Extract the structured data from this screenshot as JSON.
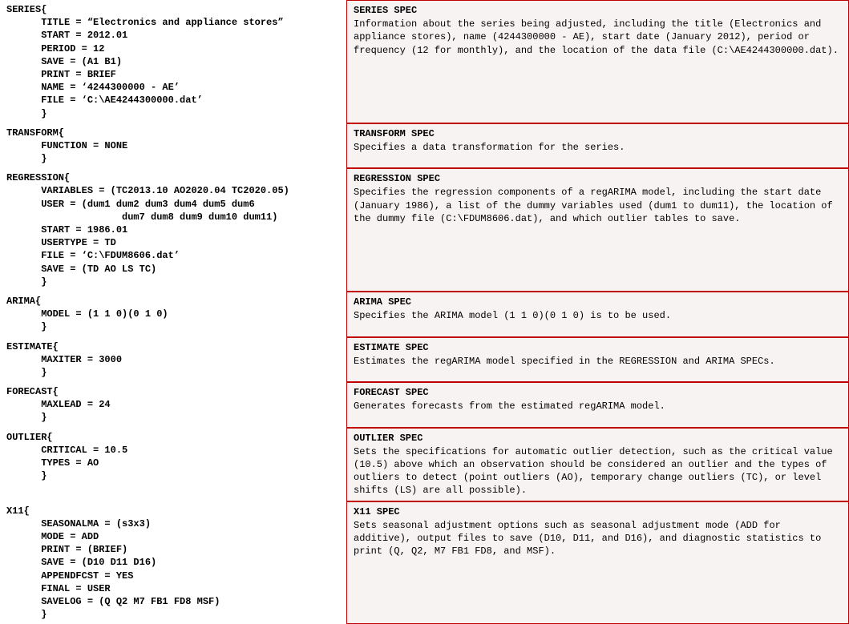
{
  "specs": [
    {
      "id": "series",
      "code": "SERIES{\n      TITLE = “Electronics and appliance stores”\n      START = 2012.01\n      PERIOD = 12\n      SAVE = (A1 B1)\n      PRINT = BRIEF\n      NAME = ‘4244300000 - AE’\n      FILE = ‘C:\\AE4244300000.dat’\n      }",
      "title": "SERIES SPEC",
      "desc": "Information about the series being adjusted, including the title (Electronics and appliance stores), name (4244300000 - AE), start date (January 2012), period or frequency (12 for monthly), and the location of the data file (C:\\AE4244300000.dat)."
    },
    {
      "id": "transform",
      "code": "TRANSFORM{\n      FUNCTION = NONE\n      }",
      "title": "TRANSFORM SPEC",
      "desc": "Specifies a data transformation for the series."
    },
    {
      "id": "regression",
      "code": "REGRESSION{\n      VARIABLES = (TC2013.10 AO2020.04 TC2020.05)\n      USER = (dum1 dum2 dum3 dum4 dum5 dum6\n                    dum7 dum8 dum9 dum10 dum11)\n      START = 1986.01\n      USERTYPE = TD\n      FILE = ‘C:\\FDUM8606.dat’\n      SAVE = (TD AO LS TC)\n      }",
      "title": "REGRESSION SPEC",
      "desc": "Specifies the regression components of a regARIMA model, including the start date (January 1986), a list of the dummy variables used (dum1 to dum11), the location of the dummy file (C:\\FDUM8606.dat), and which outlier tables to save."
    },
    {
      "id": "arima",
      "code": "ARIMA{\n      MODEL = (1 1 0)(0 1 0)\n      }",
      "title": "ARIMA SPEC",
      "desc": "Specifies the ARIMA model (1 1 0)(0 1 0) is to be used."
    },
    {
      "id": "estimate",
      "code": "ESTIMATE{\n      MAXITER = 3000\n      }",
      "title": "ESTIMATE SPEC",
      "desc": "Estimates the regARIMA model specified in the REGRESSION and ARIMA SPECs."
    },
    {
      "id": "forecast",
      "code": "FORECAST{\n      MAXLEAD = 24\n      }",
      "title": "FORECAST SPEC",
      "desc": "Generates forecasts from the estimated regARIMA model."
    },
    {
      "id": "outlier",
      "code": "OUTLIER{\n      CRITICAL = 10.5\n      TYPES = AO\n      }",
      "title": "OUTLIER SPEC",
      "desc": "Sets the specifications for automatic outlier detection, such as the critical value (10.5) above which an observation should be considered an outlier and the types of outliers to detect (point outliers (AO), temporary change outliers (TC), or level shifts (LS) are all possible)."
    },
    {
      "id": "x11",
      "code": "X11{\n      SEASONALMA = (s3x3)\n      MODE = ADD\n      PRINT = (BRIEF)\n      SAVE = (D10 D11 D16)\n      APPENDFCST = YES\n      FINAL = USER\n      SAVELOG = (Q Q2 M7 FB1 FD8 MSF)\n      }",
      "title": "X11 SPEC",
      "desc": "Sets seasonal adjustment options such as seasonal adjustment mode (ADD for additive), output files to save (D10, D11, and D16), and diagnostic statistics to print (Q, Q2, M7 FB1 FD8, and MSF)."
    }
  ]
}
